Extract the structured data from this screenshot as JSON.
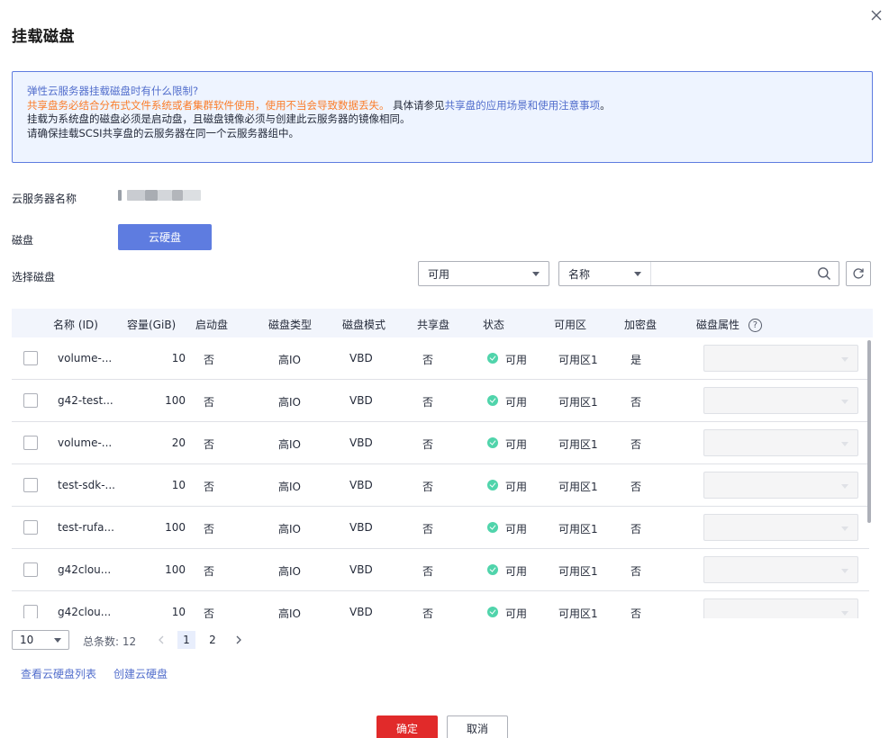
{
  "dialog": {
    "title": "挂载磁盘"
  },
  "notice": {
    "line1": "弹性云服务器挂载磁盘时有什么限制?",
    "line2_warn": "共享盘务必结合分布式文件系统或者集群软件使用，使用不当会导致数据丢失。",
    "line2_text": " 具体请参见",
    "line2_link": "共享盘的应用场景和使用注意事项",
    "line2_end": "。",
    "line3": "挂载为系统盘的磁盘必须是启动盘，且磁盘镜像必须与创建此云服务器的镜像相同。",
    "line4": "请确保挂载SCSI共享盘的云服务器在同一个云服务器组中。"
  },
  "form": {
    "server_label": "云服务器名称",
    "disk_label": "磁盘",
    "disk_tab": "云硬盘",
    "select_label": "选择磁盘"
  },
  "filters": {
    "status_value": "可用",
    "search_type": "名称",
    "search_value": ""
  },
  "table": {
    "headers": [
      "名称 (ID)",
      "容量(GiB)",
      "启动盘",
      "磁盘类型",
      "磁盘模式",
      "共享盘",
      "状态",
      "可用区",
      "加密盘",
      "磁盘属性"
    ],
    "rows": [
      {
        "name": "volume-...",
        "capacity": "10",
        "boot": "否",
        "type": "高IO",
        "mode": "VBD",
        "shared": "否",
        "status": "可用",
        "az": "可用区1",
        "encrypted": "是"
      },
      {
        "name": "g42-test...",
        "capacity": "100",
        "boot": "否",
        "type": "高IO",
        "mode": "VBD",
        "shared": "否",
        "status": "可用",
        "az": "可用区1",
        "encrypted": "否"
      },
      {
        "name": "volume-...",
        "capacity": "20",
        "boot": "否",
        "type": "高IO",
        "mode": "VBD",
        "shared": "否",
        "status": "可用",
        "az": "可用区1",
        "encrypted": "否"
      },
      {
        "name": "test-sdk-...",
        "capacity": "10",
        "boot": "否",
        "type": "高IO",
        "mode": "VBD",
        "shared": "否",
        "status": "可用",
        "az": "可用区1",
        "encrypted": "否"
      },
      {
        "name": "test-rufa...",
        "capacity": "100",
        "boot": "否",
        "type": "高IO",
        "mode": "VBD",
        "shared": "否",
        "status": "可用",
        "az": "可用区1",
        "encrypted": "否"
      },
      {
        "name": "g42clou...",
        "capacity": "100",
        "boot": "否",
        "type": "高IO",
        "mode": "VBD",
        "shared": "否",
        "status": "可用",
        "az": "可用区1",
        "encrypted": "否"
      },
      {
        "name": "g42clou...",
        "capacity": "10",
        "boot": "否",
        "type": "高IO",
        "mode": "VBD",
        "shared": "否",
        "status": "可用",
        "az": "可用区1",
        "encrypted": "否"
      }
    ]
  },
  "pager": {
    "page_size": "10",
    "total": "总条数: 12",
    "pages": [
      "1",
      "2"
    ],
    "current": "1"
  },
  "links": {
    "view_list": "查看云硬盘列表",
    "create": "创建云硬盘"
  },
  "buttons": {
    "confirm": "确定",
    "cancel": "取消"
  },
  "colors": {
    "accent": "#5e7ce0",
    "link": "#526ecc",
    "warning": "#fa7d2a",
    "primary_button": "#e12a2a",
    "status_ok": "#50d4ab",
    "notice_bg": "#eef4ff",
    "table_header_bg": "#f2f5fc"
  },
  "icons": {
    "close": "close-icon",
    "search": "search-icon",
    "refresh": "refresh-icon",
    "help": "help-icon",
    "status": "check-circle-icon"
  }
}
